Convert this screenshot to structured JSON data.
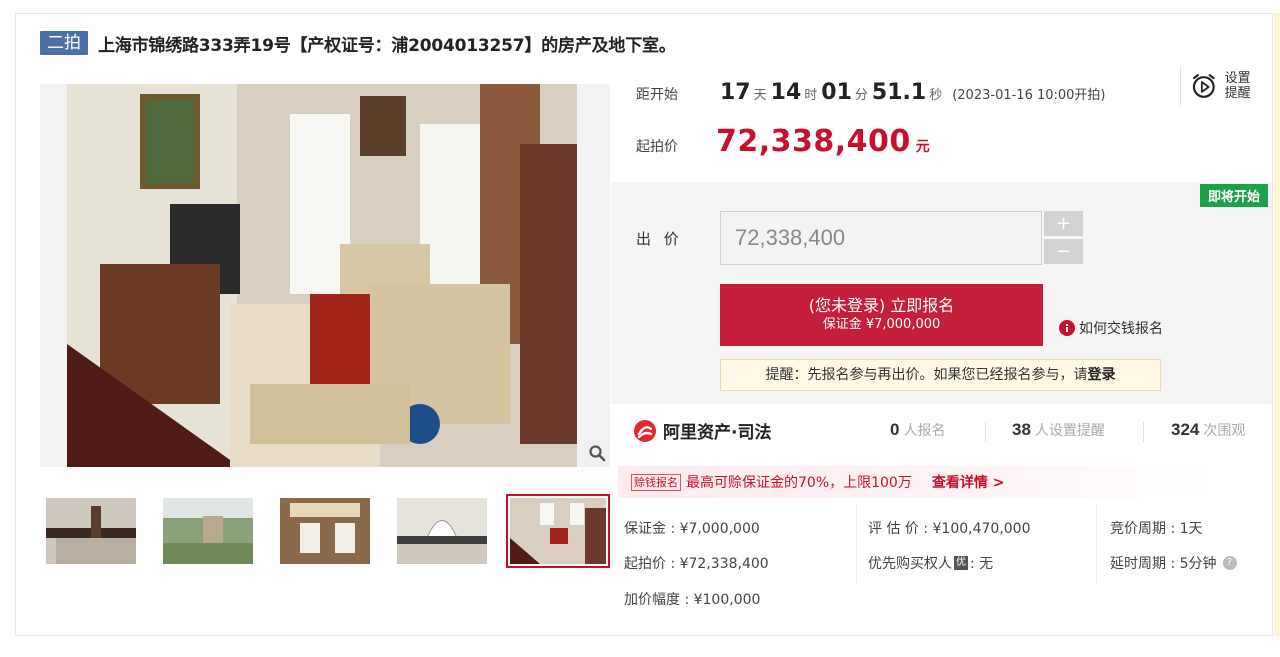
{
  "header": {
    "round_tag": "二拍",
    "title": "上海市锦绣路333弄19号【产权证号：浦2004013257】的房产及地下室。"
  },
  "countdown": {
    "label": "距开始",
    "days": "17",
    "days_unit": "天",
    "hours": "14",
    "hours_unit": "时",
    "minutes": "01",
    "minutes_unit": "分",
    "seconds": "51.1",
    "seconds_unit": "秒",
    "start_note": "(2023-01-16 10:00开拍)"
  },
  "remind": {
    "icon": "alarm-clock-icon",
    "line1": "设置",
    "line2": "提醒"
  },
  "start_price": {
    "label": "起拍价",
    "value": "72,338,400",
    "unit": "元"
  },
  "bid": {
    "status_badge": "即将开始",
    "label": "出 价",
    "input_value": "72,338,400",
    "plus_label": "+",
    "minus_label": "−",
    "signup_main": "(您未登录) 立即报名",
    "signup_sub": "保证金 ¥7,000,000",
    "how_to_pay": "如何交钱报名",
    "tip_prefix": "提醒：先报名参与再出价。如果您已经报名参与，请",
    "tip_link": "登录"
  },
  "stats": {
    "brand_name": "阿里资产·司法",
    "signups_num": "0",
    "signups_label": "人报名",
    "reminders_num": "38",
    "reminders_label": "人设置提醒",
    "views_num": "324",
    "views_label": "次围观"
  },
  "promo": {
    "tag": "赊钱报名",
    "text": "最高可赊保证金的70%，上限100万",
    "link": "查看详情 >"
  },
  "info": {
    "deposit": "保证金 : ¥7,000,000",
    "appraisal": "评 估 价 : ¥100,470,000",
    "period": "竞价周期 : 1天",
    "start_price": "起拍价 : ¥72,338,400",
    "priority_label": "优先购买权人",
    "priority_icon": "优",
    "priority_value": ": 无",
    "delay": "延时周期 : 5分钟",
    "increment": "加价幅度 : ¥100,000"
  },
  "colors": {
    "accent_red": "#c8102e",
    "button_red": "#c41e3a",
    "tag_blue": "#4d6fa7",
    "badge_green": "#1aa14a"
  }
}
